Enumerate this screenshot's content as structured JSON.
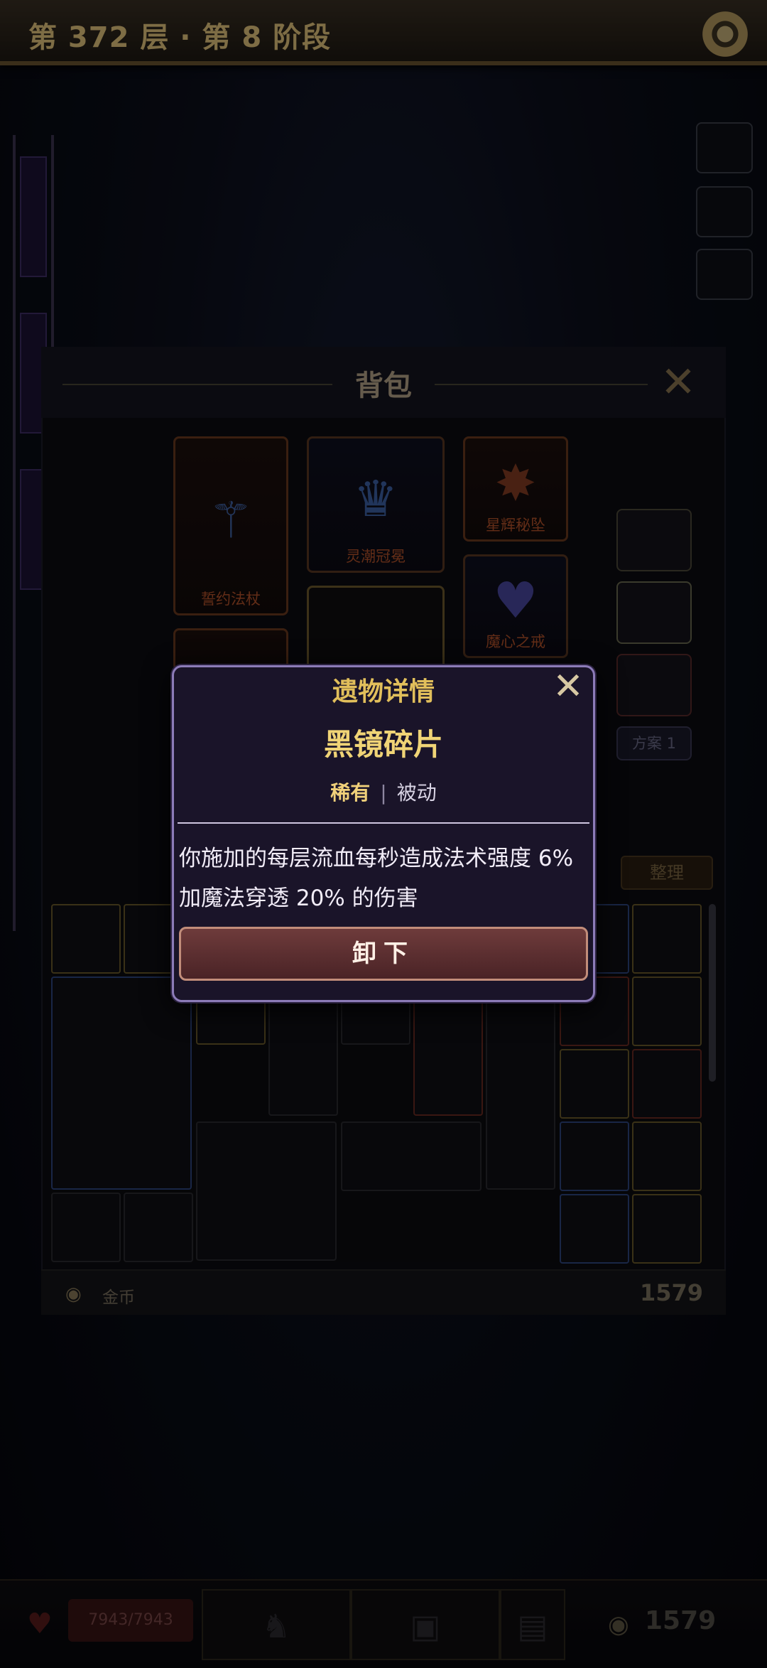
{
  "header": {
    "title": "第 372 层 · 第 8 阶段",
    "settings_icon": "gear-icon"
  },
  "inventory": {
    "title": "背包",
    "equipment": [
      {
        "label": "誓约法杖",
        "icon": "staff-icon"
      },
      {
        "label": "灵潮冠冕",
        "icon": "crown-icon"
      },
      {
        "label": "星辉秘坠",
        "icon": "amulet-icon"
      },
      {
        "label": "魔心之戒",
        "icon": "ring-icon"
      }
    ],
    "plan_label": "方案 1",
    "sort_label": "整理",
    "currency": {
      "label": "金币",
      "value": "1579"
    }
  },
  "dialog": {
    "header": "遗物详情",
    "name": "黑镜碎片",
    "rarity": "稀有",
    "separator": "|",
    "type": "被动",
    "description": "你施加的每层流血每秒造成法术强度 6% 加魔法穿透 20% 的伤害",
    "button_label": "卸下"
  },
  "hud": {
    "hp": "7943/7943",
    "gold": "1579"
  },
  "colors": {
    "accent_gold": "#e1bf5b",
    "dialog_border": "#8c7bb8",
    "unequip_button": "#6e3b3b",
    "equip_label_red": "#b4532b"
  }
}
